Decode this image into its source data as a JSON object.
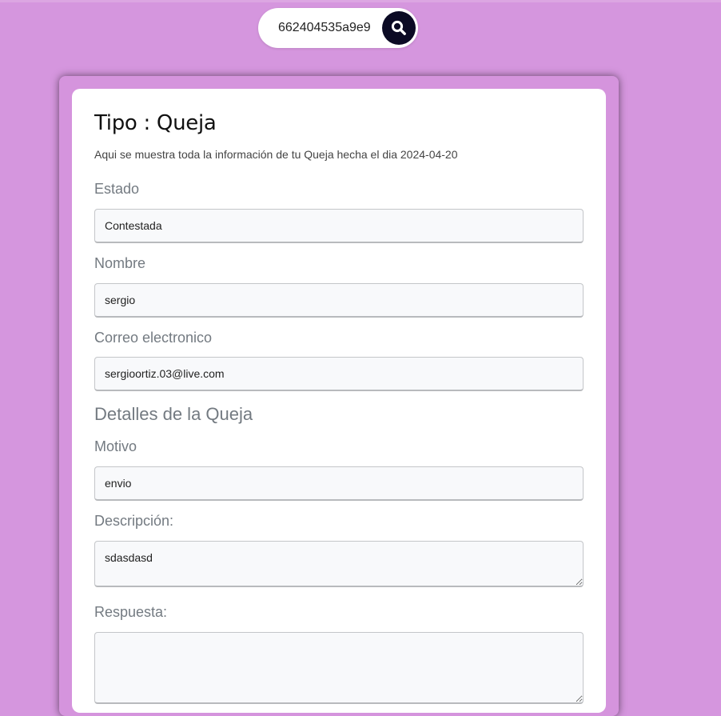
{
  "search": {
    "value": "662404535a9e9",
    "button_icon": "search-icon"
  },
  "card": {
    "title": "Tipo : Queja",
    "subtitle": "Aqui se muestra toda la información de tu Queja hecha el dia 2024-04-20",
    "estado": {
      "label": "Estado",
      "value": "Contestada"
    },
    "nombre": {
      "label": "Nombre",
      "value": "sergio"
    },
    "correo": {
      "label": "Correo electronico",
      "value": "sergioortiz.03@live.com"
    },
    "details_heading": "Detalles de la Queja",
    "motivo": {
      "label": "Motivo",
      "value": "envio"
    },
    "descripcion": {
      "label": "Descripción:",
      "value": "sdasdasd"
    },
    "respuesta": {
      "label": "Respuesta:",
      "value": ""
    }
  },
  "colors": {
    "background": "#d596de",
    "search_button": "#0b0a24",
    "label_text": "#737a81"
  }
}
